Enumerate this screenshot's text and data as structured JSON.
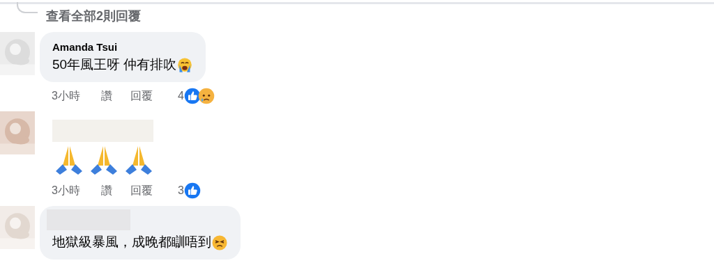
{
  "view_replies": {
    "label": "查看全部2則回覆"
  },
  "comments": [
    {
      "kind": "bubble",
      "author": "Amanda Tsui",
      "name_redacted": false,
      "text": "50年風王呀 仲有排吹",
      "emojis": [
        {
          "kind": "crying"
        }
      ],
      "time": "3小時",
      "like": "讚",
      "reply": "回覆",
      "reaction_count": "4",
      "reactions": [
        {
          "kind": "like"
        },
        {
          "kind": "sad"
        }
      ]
    },
    {
      "kind": "plain",
      "name_redacted": true,
      "emojis": [
        {
          "kind": "praying"
        },
        {
          "kind": "praying"
        },
        {
          "kind": "praying"
        }
      ],
      "time": "3小時",
      "like": "讚",
      "reply": "回覆",
      "reaction_count": "3",
      "reactions": [
        {
          "kind": "like"
        }
      ]
    },
    {
      "kind": "bubble",
      "name_redacted": true,
      "text": "地獄級暴風，成晚都瞓唔到",
      "emojis": [
        {
          "kind": "persevering"
        }
      ]
    }
  ]
}
